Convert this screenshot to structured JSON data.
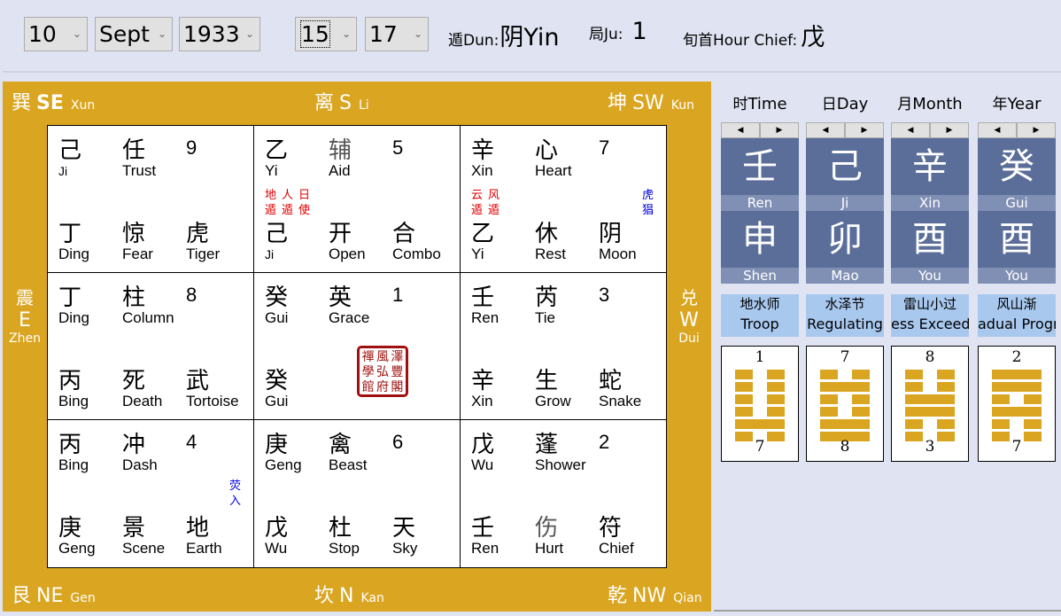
{
  "topbar": {
    "day": "10",
    "month": "Sept",
    "year": "1933",
    "hour": "15",
    "minute": "17",
    "dun_label": "遁Dun:",
    "dun_value": "阴Yin",
    "ju_label": "局Ju:",
    "ju_value": "1",
    "chief_label": "旬首Hour Chief:",
    "chief_value": "戊",
    "chevron": "⌄"
  },
  "directions": {
    "se": {
      "zh": "巽",
      "en": "SE",
      "py": "Xun"
    },
    "s": {
      "zh": "离",
      "en": "S",
      "py": "Li"
    },
    "sw": {
      "zh": "坤",
      "en": "SW",
      "py": "Kun"
    },
    "e": {
      "zh": "震",
      "en": "E",
      "py": "Zhen"
    },
    "w": {
      "zh": "兑",
      "en": "W",
      "py": "Dui"
    },
    "ne": {
      "zh": "艮",
      "en": "NE",
      "py": "Gen"
    },
    "n": {
      "zh": "坎",
      "en": "N",
      "py": "Kan"
    },
    "nw": {
      "zh": "乾",
      "en": "NW",
      "py": "Qian"
    }
  },
  "palaces": [
    {
      "heaven_stem": {
        "zh": "己",
        "en": "Ji"
      },
      "star": {
        "zh": "任",
        "en": "Trust"
      },
      "number": "9",
      "earth_stem": {
        "zh": "丁",
        "en": "Ding"
      },
      "door": {
        "zh": "惊",
        "en": "Fear"
      },
      "deity": {
        "zh": "虎",
        "en": "Tiger"
      }
    },
    {
      "heaven_stem": {
        "zh": "乙",
        "en": "Yi"
      },
      "star": {
        "zh": "辅",
        "en": "Aid"
      },
      "number": "5",
      "earth_stem": {
        "zh": "己",
        "en": "Ji"
      },
      "door": {
        "zh": "开",
        "en": "Open"
      },
      "deity": {
        "zh": "合",
        "en": "Combo"
      },
      "red_marks": [
        [
          "地",
          "遁"
        ],
        [
          "人",
          "遁"
        ],
        [
          "日",
          "使"
        ]
      ]
    },
    {
      "heaven_stem": {
        "zh": "辛",
        "en": "Xin"
      },
      "star": {
        "zh": "心",
        "en": "Heart"
      },
      "number": "7",
      "earth_stem": {
        "zh": "乙",
        "en": "Yi"
      },
      "door": {
        "zh": "休",
        "en": "Rest"
      },
      "deity": {
        "zh": "阴",
        "en": "Moon"
      },
      "red_marks": [
        [
          "云",
          "遁"
        ],
        [
          "风",
          "遁"
        ]
      ],
      "blue_mark": [
        "虎",
        "猖"
      ]
    },
    {
      "heaven_stem": {
        "zh": "丁",
        "en": "Ding"
      },
      "star": {
        "zh": "柱",
        "en": "Column"
      },
      "number": "8",
      "earth_stem": {
        "zh": "丙",
        "en": "Bing"
      },
      "door": {
        "zh": "死",
        "en": "Death"
      },
      "deity": {
        "zh": "武",
        "en": "Tortoise"
      }
    },
    {
      "heaven_stem": {
        "zh": "癸",
        "en": "Gui"
      },
      "star": {
        "zh": "英",
        "en": "Grace"
      },
      "number": "1",
      "earth_stem": {
        "zh": "癸",
        "en": "Gui"
      },
      "seal": [
        "禪",
        "風",
        "澤",
        "學",
        "弘",
        "豐",
        "館",
        "府",
        "閣"
      ]
    },
    {
      "heaven_stem": {
        "zh": "壬",
        "en": "Ren"
      },
      "star": {
        "zh": "芮",
        "en": "Tie"
      },
      "number": "3",
      "earth_stem": {
        "zh": "辛",
        "en": "Xin"
      },
      "door": {
        "zh": "生",
        "en": "Grow"
      },
      "deity": {
        "zh": "蛇",
        "en": "Snake"
      }
    },
    {
      "heaven_stem": {
        "zh": "丙",
        "en": "Bing"
      },
      "star": {
        "zh": "冲",
        "en": "Dash"
      },
      "number": "4",
      "earth_stem": {
        "zh": "庚",
        "en": "Geng"
      },
      "door": {
        "zh": "景",
        "en": "Scene"
      },
      "deity": {
        "zh": "地",
        "en": "Earth"
      },
      "blue_mark": [
        "荧",
        "入"
      ]
    },
    {
      "heaven_stem": {
        "zh": "庚",
        "en": "Geng"
      },
      "star": {
        "zh": "禽",
        "en": "Beast"
      },
      "number": "6",
      "earth_stem": {
        "zh": "戊",
        "en": "Wu"
      },
      "door": {
        "zh": "杜",
        "en": "Stop"
      },
      "deity": {
        "zh": "天",
        "en": "Sky"
      }
    },
    {
      "heaven_stem": {
        "zh": "戊",
        "en": "Wu"
      },
      "star": {
        "zh": "蓬",
        "en": "Shower"
      },
      "number": "2",
      "earth_stem": {
        "zh": "壬",
        "en": "Ren"
      },
      "door": {
        "zh": "伤",
        "en": "Hurt"
      },
      "deity": {
        "zh": "符",
        "en": "Chief"
      }
    }
  ],
  "pillars": [
    {
      "title_zh": "时",
      "title_en": "Time",
      "stem": "壬",
      "stem_py": "Ren",
      "branch": "申",
      "branch_py": "Shen",
      "hex_zh": "地水师",
      "hex_en": "Troop",
      "hex_top": "1",
      "hex_bottom": "7",
      "hex_lines": [
        0,
        0,
        0,
        0,
        1,
        0
      ]
    },
    {
      "title_zh": "日",
      "title_en": "Day",
      "stem": "己",
      "stem_py": "Ji",
      "branch": "卯",
      "branch_py": "Mao",
      "hex_zh": "水泽节",
      "hex_en": "Regulating",
      "hex_top": "7",
      "hex_bottom": "8",
      "hex_lines": [
        0,
        1,
        0,
        0,
        1,
        1
      ]
    },
    {
      "title_zh": "月",
      "title_en": "Month",
      "stem": "辛",
      "stem_py": "Xin",
      "branch": "酉",
      "branch_py": "You",
      "hex_zh": "雷山小过",
      "hex_en": "ess Exceedin",
      "hex_top": "8",
      "hex_bottom": "3",
      "hex_lines": [
        0,
        0,
        1,
        1,
        0,
        0
      ]
    },
    {
      "title_zh": "年",
      "title_en": "Year",
      "stem": "癸",
      "stem_py": "Gui",
      "branch": "酉",
      "branch_py": "You",
      "hex_zh": "风山渐",
      "hex_en": "adual Progre",
      "hex_top": "2",
      "hex_bottom": "7",
      "hex_lines": [
        1,
        1,
        0,
        1,
        0,
        0
      ]
    }
  ],
  "arrows": {
    "left": "◀",
    "right": "▶"
  },
  "colors": {
    "board": "#daa520",
    "stem_bg": "#5a6e99",
    "label_bg": "#8090b4",
    "hex_name_bg": "#a8c8ee",
    "red_mark": "#e00000",
    "blue_mark": "#0000e0",
    "seal": "#a01010"
  }
}
